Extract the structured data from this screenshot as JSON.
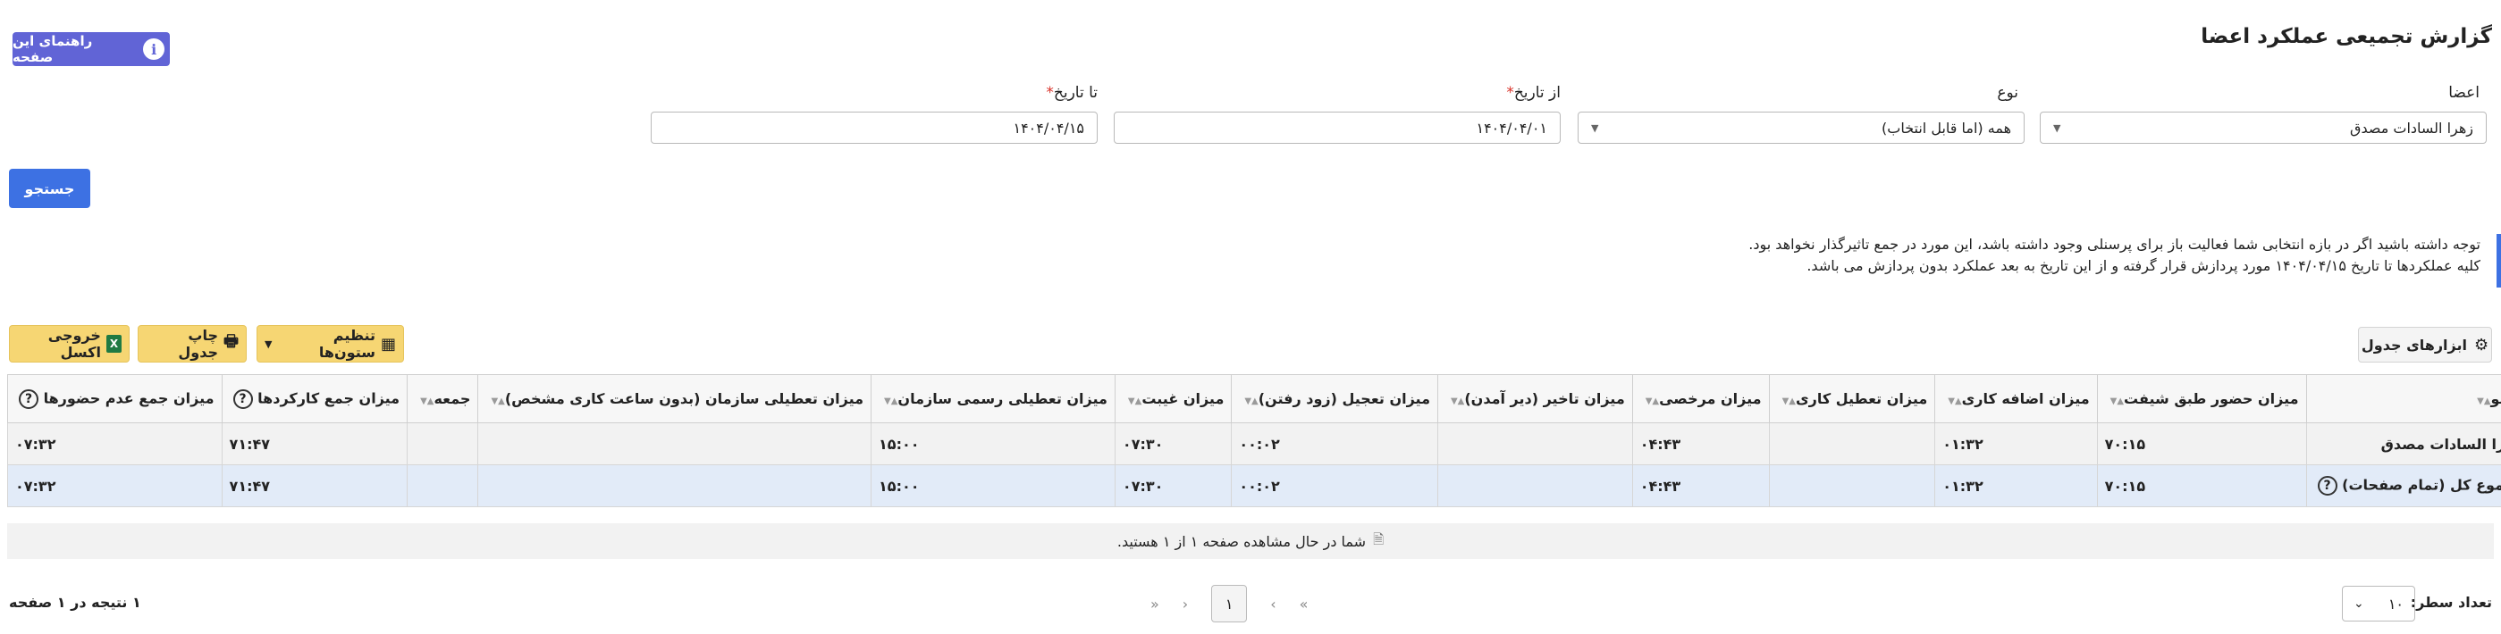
{
  "page": {
    "title": "گزارش تجمیعی عملکرد اعضا",
    "help_label": "راهنمای این صفحه"
  },
  "filters": {
    "member": {
      "label": "اعضا",
      "value": "زهرا السادات مصدق"
    },
    "type": {
      "label": "نوع",
      "value": "همه (اما قابل انتخاب)"
    },
    "from_date": {
      "label": "از تاریخ",
      "required_mark": "*",
      "value": "۱۴۰۴/۰۴/۰۱"
    },
    "to_date": {
      "label": "تا تاریخ",
      "required_mark": "*",
      "value": "۱۴۰۴/۰۴/۱۵"
    },
    "search_label": "جستجو"
  },
  "notice": {
    "line1": "توجه داشته باشید اگر در بازه انتخابی شما فعالیت باز برای پرسنلی وجود داشته باشد، این مورد در جمع تاثیرگذار نخواهد بود.",
    "line2": "کلیه عملکردها تا تاریخ ۱۴۰۴/۰۴/۱۵ مورد پردازش قرار گرفته و از این تاریخ به بعد عملکرد بدون پردازش می باشد."
  },
  "toolbar": {
    "table_tools": "ابزارهای جدول",
    "column_settings": "تنظیم ستون‌ها",
    "print_table": "چاپ جدول",
    "excel_export": "خروجی اکسل"
  },
  "table": {
    "columns": [
      "عضو",
      "میزان حضور طبق شیفت",
      "میزان اضافه کاری",
      "میزان تعطیل کاری",
      "میزان مرخصی",
      "میزان تاخیر (دیر آمدن)",
      "میزان تعجیل (زود رفتن)",
      "میزان غیبت",
      "میزان تعطیلی رسمی سازمان",
      "میزان تعطیلی سازمان (بدون ساعت کاری مشخص)",
      "جمعه",
      "میزان جمع کارکردها",
      "میزان جمع عدم حضورها"
    ],
    "rows": [
      [
        "زهرا السادات مصدق",
        "۷۰:۱۵",
        "۰۱:۳۲",
        "",
        "۰۴:۴۳",
        "",
        "۰۰:۰۲",
        "۰۷:۳۰",
        "۱۵:۰۰",
        "",
        "",
        "۷۱:۴۷",
        "۰۷:۳۲"
      ],
      [
        "مجموع کل (تمام صفحات)",
        "۷۰:۱۵",
        "۰۱:۳۲",
        "",
        "۰۴:۴۳",
        "",
        "۰۰:۰۲",
        "۰۷:۳۰",
        "۱۵:۰۰",
        "",
        "",
        "۷۱:۴۷",
        "۰۷:۳۲"
      ]
    ]
  },
  "paging": {
    "status": "شما در حال مشاهده صفحه ۱ از ۱ هستید.",
    "current_page": "۱",
    "first": "«",
    "prev": "‹",
    "next": "›",
    "last": "»",
    "rows_label": "تعداد سطر:",
    "rows_value": "۱۰",
    "result_summary": "۱ نتیجه در ۱ صفحه"
  },
  "colors": {
    "primary": "#3d71e3",
    "help": "#6164d6",
    "toolbar": "#f6d673",
    "total_row": "#e2ebf8"
  }
}
